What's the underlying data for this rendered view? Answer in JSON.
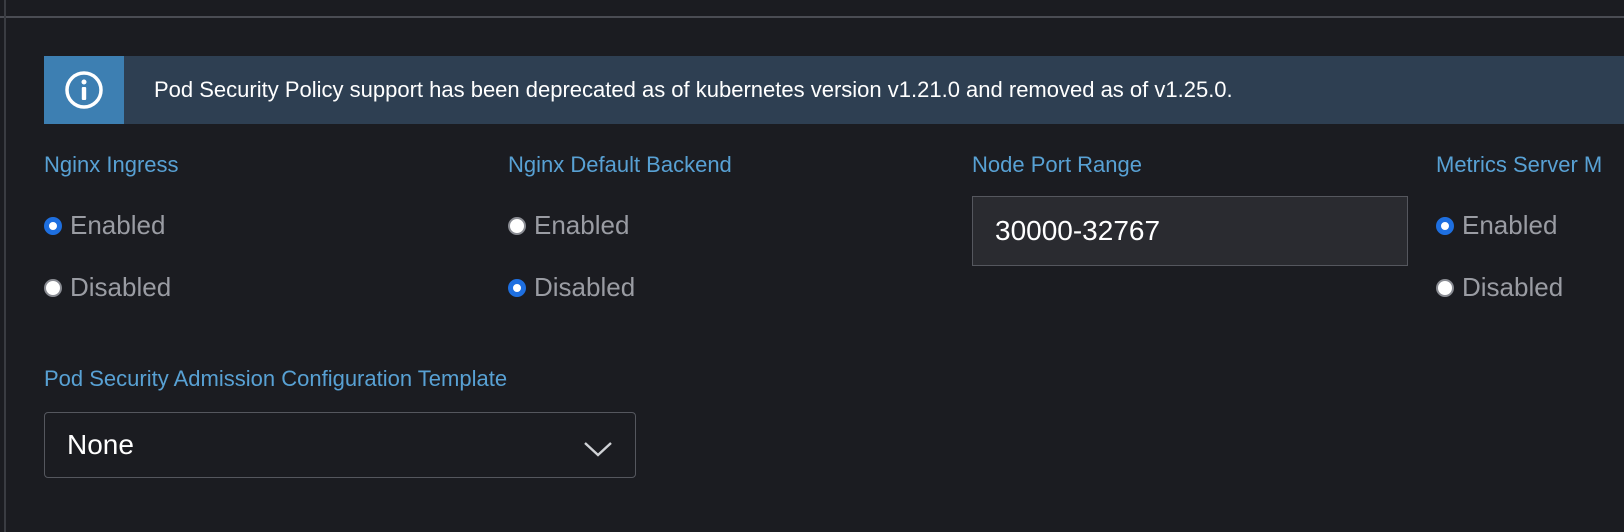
{
  "banner": {
    "icon": "info-icon",
    "text": "Pod Security Policy support has been deprecated as of kubernetes version v1.21.0 and removed as of v1.25.0."
  },
  "nginx_ingress": {
    "label": "Nginx Ingress",
    "options": [
      {
        "label": "Enabled",
        "selected": true
      },
      {
        "label": "Disabled",
        "selected": false
      }
    ]
  },
  "nginx_default_backend": {
    "label": "Nginx Default Backend",
    "options": [
      {
        "label": "Enabled",
        "selected": false
      },
      {
        "label": "Disabled",
        "selected": true
      }
    ]
  },
  "node_port_range": {
    "label": "Node Port Range",
    "value": "30000-32767"
  },
  "metrics_server": {
    "label": "Metrics Server M",
    "options": [
      {
        "label": "Enabled",
        "selected": true
      },
      {
        "label": "Disabled",
        "selected": false
      }
    ]
  },
  "psa_template": {
    "label": "Pod Security Admission Configuration Template",
    "value": "None"
  },
  "colors": {
    "background": "#1b1c21",
    "label": "#58a1d4",
    "banner": "#2e3f52",
    "banner_icon_bg": "#3d7fb2",
    "radio_selected": "#1e6fe0"
  }
}
